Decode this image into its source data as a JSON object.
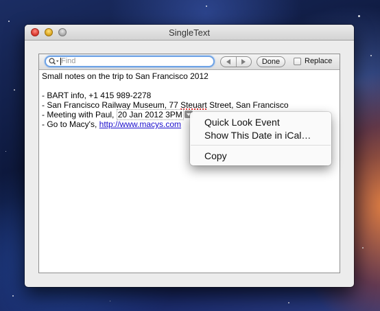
{
  "window": {
    "title": "SingleText"
  },
  "find_bar": {
    "search_placeholder": "Find",
    "done_label": "Done",
    "replace_label": "Replace",
    "replace_checked": false
  },
  "document": {
    "line1": "Small notes on the trip to San Francisco 2012",
    "line3": "- BART info, +1 415 989-2278",
    "line4_a": "- San Francisco Railway Museum, 77 ",
    "line4_b": "Steuart",
    "line4_c": " Street, San Francisco",
    "line5_a": "- Meeting with Paul, ",
    "line5_date": "20 Jan 2012 3PM",
    "line6_a": "- Go to Macy's, ",
    "line6_link": "http://www.macys.com"
  },
  "context_menu": {
    "items": [
      "Quick Look Event",
      "Show This Date in iCal…",
      "Copy"
    ]
  },
  "colors": {
    "link": "#1a0dcc",
    "focus_ring": "#6fa3e6"
  }
}
